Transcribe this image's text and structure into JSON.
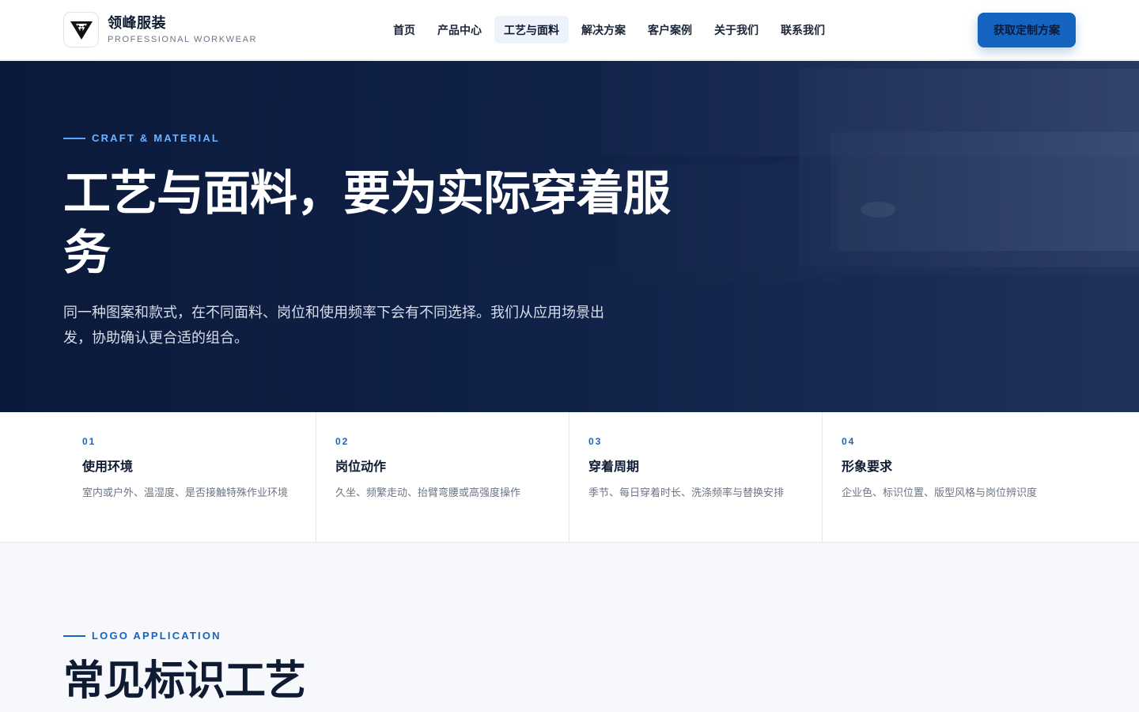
{
  "brand": {
    "name": "领峰服装",
    "tagline": "PROFESSIONAL WORKWEAR"
  },
  "nav": {
    "items": [
      {
        "label": "首页",
        "active": false
      },
      {
        "label": "产品中心",
        "active": false
      },
      {
        "label": "工艺与面料",
        "active": true
      },
      {
        "label": "解决方案",
        "active": false
      },
      {
        "label": "客户案例",
        "active": false
      },
      {
        "label": "关于我们",
        "active": false
      },
      {
        "label": "联系我们",
        "active": false
      }
    ],
    "cta_label": "获取定制方案"
  },
  "hero": {
    "eyebrow": "CRAFT & MATERIAL",
    "title": "工艺与面料，要为实际穿着服务",
    "description": "同一种图案和款式，在不同面料、岗位和使用频率下会有不同选择。我们从应用场景出发，协助确认更合适的组合。"
  },
  "features": [
    {
      "number": "01",
      "title": "使用环境",
      "description": "室内或户外、温湿度、是否接触特殊作业环境"
    },
    {
      "number": "02",
      "title": "岗位动作",
      "description": "久坐、频繁走动、抬臂弯腰或高强度操作"
    },
    {
      "number": "03",
      "title": "穿着周期",
      "description": "季节、每日穿着时长、洗涤频率与替换安排"
    },
    {
      "number": "04",
      "title": "形象要求",
      "description": "企业色、标识位置、版型风格与岗位辨识度"
    }
  ],
  "logo_section": {
    "eyebrow": "LOGO APPLICATION",
    "title": "常见标识工艺"
  },
  "colors": {
    "accent": "#1565c0",
    "hero_bg": "#0b1a3a",
    "eyebrow_light": "#6fb3ff"
  }
}
